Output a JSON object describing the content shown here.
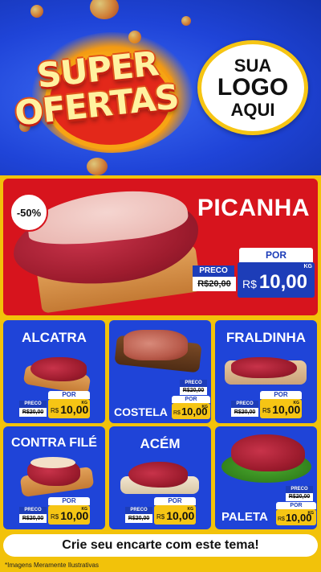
{
  "header": {
    "title_line1": "SUPER",
    "title_line2": "OFERTAS",
    "logo_line1": "SUA",
    "logo_line2": "LOGO",
    "logo_line3": "AQUI"
  },
  "main_offer": {
    "discount_badge": "-50%",
    "name": "PICANHA",
    "preco_label": "PRECO",
    "old_price": "R$20,00",
    "por_label": "POR",
    "currency": "R$",
    "price": "10,00",
    "unit": "KG"
  },
  "products": [
    {
      "name": "ALCATRA",
      "preco_label": "PRECO",
      "old_price": "R$20,00",
      "por_label": "POR",
      "currency": "R$",
      "price": "10,00",
      "unit": "KG"
    },
    {
      "name": "COSTELA",
      "preco_label": "PRECO",
      "old_price": "R$20,00",
      "por_label": "POR",
      "currency": "R$",
      "price": "10,00",
      "unit": "KG"
    },
    {
      "name": "FRALDINHA",
      "preco_label": "PRECO",
      "old_price": "R$20,00",
      "por_label": "POR",
      "currency": "R$",
      "price": "10,00",
      "unit": "KG"
    },
    {
      "name": "CONTRA FILÉ",
      "preco_label": "PRECO",
      "old_price": "R$20,00",
      "por_label": "POR",
      "currency": "R$",
      "price": "10,00",
      "unit": "KG"
    },
    {
      "name": "ACÉM",
      "preco_label": "PRECO",
      "old_price": "R$20,00",
      "por_label": "POR",
      "currency": "R$",
      "price": "10,00",
      "unit": "KG"
    },
    {
      "name": "PALETA",
      "preco_label": "PRECO",
      "old_price": "R$20,00",
      "por_label": "POR",
      "currency": "R$",
      "price": "10,00",
      "unit": "KG"
    }
  ],
  "footer": {
    "cta_text": "Crie seu encarte com este tema!",
    "disclaimer": "*Imagens Meramente Ilustrativas"
  },
  "colors": {
    "brand_blue": "#1f44d8",
    "brand_red": "#d7141d",
    "brand_yellow": "#f6c514"
  }
}
